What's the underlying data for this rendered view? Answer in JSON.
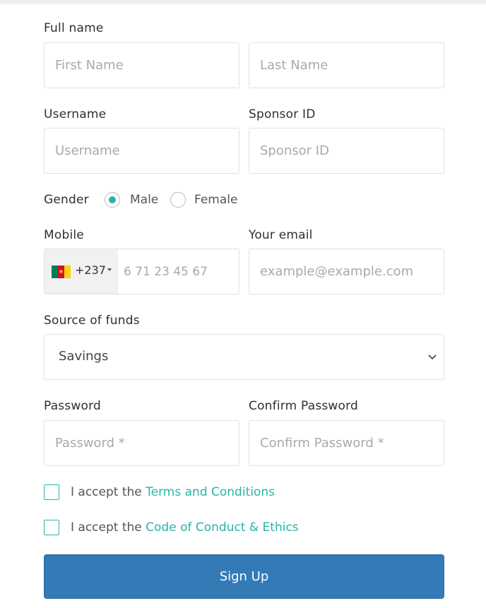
{
  "form": {
    "full_name_label": "Full name",
    "first_name_placeholder": "First Name",
    "last_name_placeholder": "Last Name",
    "username_label": "Username",
    "username_placeholder": "Username",
    "sponsor_label": "Sponsor ID",
    "sponsor_placeholder": "Sponsor ID",
    "gender_label": "Gender",
    "gender_options": [
      "Male",
      "Female"
    ],
    "gender_selected": "Male",
    "mobile_label": "Mobile",
    "phone_dial_code": "+237",
    "phone_placeholder": "6 71 23 45 67",
    "phone_flag_colors": [
      "#007a5e",
      "#ce1126",
      "#fcd116"
    ],
    "email_label": "Your email",
    "email_placeholder": "example@example.com",
    "source_label": "Source of funds",
    "source_value": "Savings",
    "password_label": "Password",
    "password_placeholder": "Password *",
    "confirm_password_label": "Confirm Password",
    "confirm_password_placeholder": "Confirm Password *",
    "terms_prefix": "I accept the",
    "terms_link": "Terms and Conditions",
    "conduct_prefix": "I accept the",
    "conduct_link": "Code of Conduct & Ethics",
    "signup_label": "Sign Up"
  },
  "colors": {
    "accent": "#2bb3a8",
    "button": "#337ab7"
  },
  "icons": {
    "select_chevron": "chevron-down-icon",
    "dial_caret": "caret-down-icon"
  }
}
